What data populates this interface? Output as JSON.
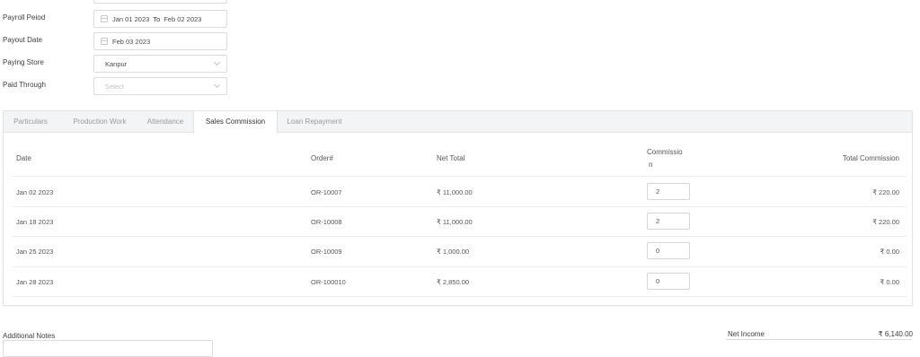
{
  "form": {
    "payroll_period": {
      "label": "Payroll Peiod",
      "from": "Jan 01 2023",
      "to_word": "To",
      "to": "Feb 02 2023"
    },
    "payout_date": {
      "label": "Payout Date",
      "value": "Feb 03 2023"
    },
    "paying_store": {
      "label": "Paying Store",
      "value": "Kanpur"
    },
    "paid_through": {
      "label": "Paid Through",
      "placeholder": "Select"
    }
  },
  "tabs": [
    {
      "label": "Particulars",
      "active": false
    },
    {
      "label": "Production Work",
      "active": false
    },
    {
      "label": "Attendance",
      "active": false
    },
    {
      "label": "Sales Commission",
      "active": true
    },
    {
      "label": "Loan Repayment",
      "active": false
    }
  ],
  "table": {
    "headers": {
      "date": "Date",
      "order": "Order#",
      "net_total": "Net Total",
      "commission_1": "Commissio",
      "commission_2": "n",
      "total_commission": "Total Commission"
    },
    "rows": [
      {
        "date": "Jan 02 2023",
        "order": "OR-10007",
        "net_total": "₹ 11,000.00",
        "commission": "2",
        "total_commission": "₹ 220.00"
      },
      {
        "date": "Jan 18 2023",
        "order": "OR-10008",
        "net_total": "₹ 11,000.00",
        "commission": "2",
        "total_commission": "₹ 220.00"
      },
      {
        "date": "Jan 25 2023",
        "order": "OR-10009",
        "net_total": "₹ 1,000.00",
        "commission": "0",
        "total_commission": "₹ 0.00"
      },
      {
        "date": "Jan 28 2023",
        "order": "OR-100010",
        "net_total": "₹ 2,850.00",
        "commission": "0",
        "total_commission": "₹ 0.00"
      }
    ]
  },
  "footer": {
    "additional_notes_label": "Additional Notes",
    "net_income_label": "Net Income",
    "net_income_value": "₹ 6,140.00"
  }
}
